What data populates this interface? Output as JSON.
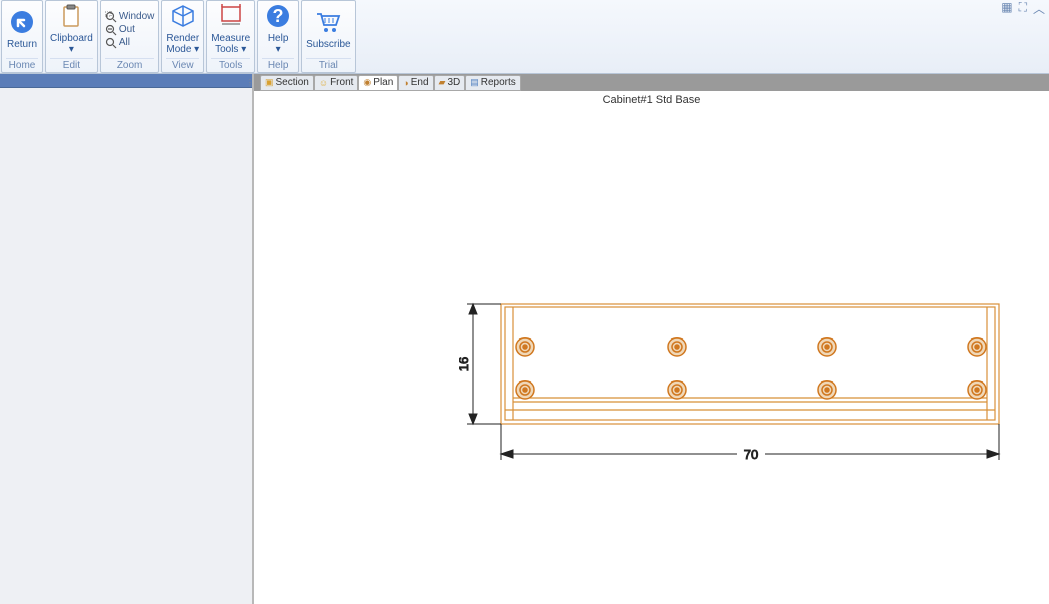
{
  "ribbon": {
    "return": {
      "label": "Return",
      "group": "Home"
    },
    "clipboard": {
      "label": "Clipboard",
      "group": "Edit"
    },
    "zoom": {
      "window": "Window",
      "out": "Out",
      "all": "All",
      "group": "Zoom"
    },
    "render": {
      "label1": "Render",
      "label2": "Mode",
      "group": "View"
    },
    "measure": {
      "label1": "Measure",
      "label2": "Tools",
      "group": "Tools"
    },
    "help": {
      "label": "Help",
      "group": "Help"
    },
    "subscribe": {
      "label": "Subscribe",
      "group": "Trial"
    }
  },
  "tabs": {
    "section": "Section",
    "front": "Front",
    "plan": "Plan",
    "end": "End",
    "d3": "3D",
    "reports": "Reports"
  },
  "document": {
    "title": "Cabinet#1 Std Base"
  },
  "dimensions": {
    "height": "16",
    "width": "70"
  }
}
